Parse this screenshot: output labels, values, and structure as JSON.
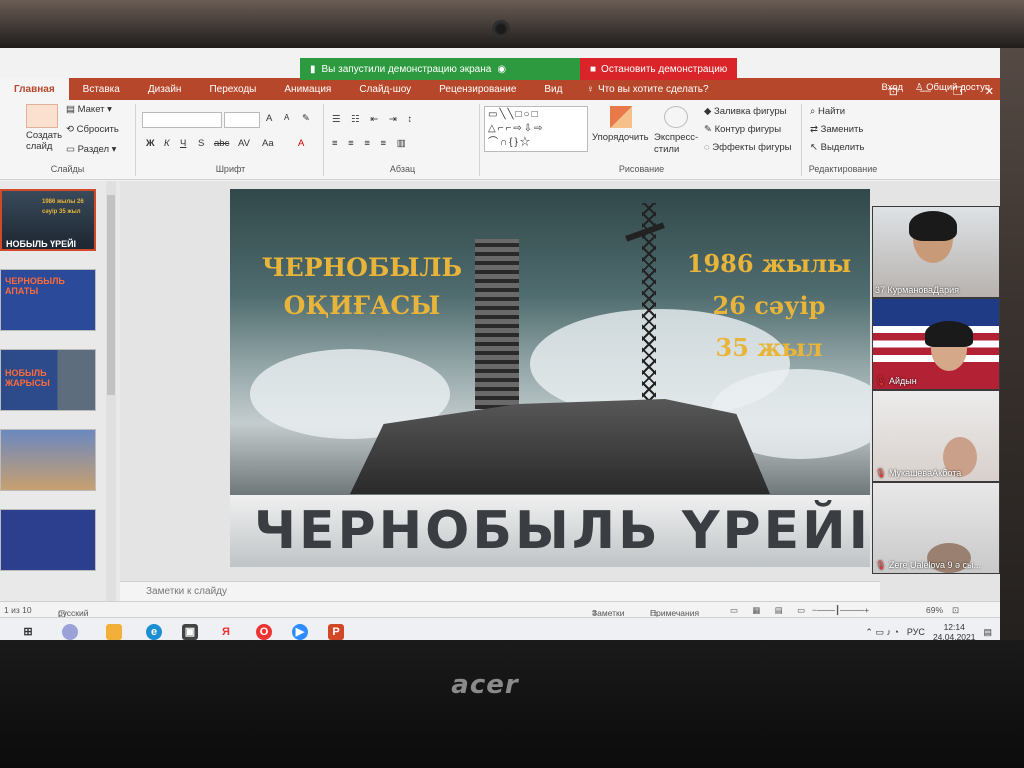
{
  "share": {
    "message": "Вы запустили демонстрацию экрана",
    "stop_label": "Остановить демонстрацию"
  },
  "ribbon_tabs": [
    "Главная",
    "Вставка",
    "Дизайн",
    "Переходы",
    "Анимация",
    "Слайд-шоу",
    "Рецензирование",
    "Вид"
  ],
  "tell_me": "Что вы хотите сделать?",
  "tab_right": {
    "signin": "Вход",
    "share": "Общий доступ"
  },
  "ribbon": {
    "slides": {
      "new_slide": "Создать слайд",
      "layout": "Макет",
      "reset": "Сбросить",
      "section": "Раздел",
      "label": "Слайды"
    },
    "font": {
      "label": "Шрифт",
      "bold": "Ж",
      "italic": "К",
      "underline": "Ч",
      "shadow": "S",
      "strikethrough": "abc",
      "spacing": "AV",
      "case": "Aa",
      "grow": "A",
      "shrink": "A"
    },
    "paragraph": {
      "label": "Абзац"
    },
    "drawing": {
      "label": "Рисование",
      "arrange": "Упорядочить",
      "quick_styles": "Экспресс-стили",
      "fill": "Заливка фигуры",
      "outline": "Контур фигуры",
      "effects": "Эффекты фигуры"
    },
    "editing": {
      "label": "Редактирование",
      "find": "Найти",
      "replace": "Заменить",
      "select": "Выделить"
    }
  },
  "slide": {
    "title_line1": "ЧЕРНОБЫЛЬ",
    "title_line2": "ОҚИҒАСЫ",
    "date_line1": "1986 жылы",
    "date_line2": "26 сәуір",
    "date_line3": "35 жыл",
    "banner": "ЧЕРНОБЫЛЬ ҮРЕЙІ"
  },
  "thumbnails": [
    {
      "label": "1986 жылы 26 сәуір 35 жыл",
      "title": "НОБЫЛЬ ҮРЕЙІ"
    },
    {
      "label": "ЧЕРНОБЫЛЬ АПАТЫ",
      "title": ""
    },
    {
      "label": "НОБЫЛЬ ЖАРЫСЫ",
      "title": ""
    },
    {
      "label": "",
      "title": ""
    },
    {
      "label": "",
      "title": ""
    }
  ],
  "participants": [
    {
      "name": "37 КурмановаДария"
    },
    {
      "name": "Айдын"
    },
    {
      "name": "МукашеваАкбота"
    },
    {
      "name": "Zere Ualelova 9 ә сы..."
    }
  ],
  "notes_placeholder": "Заметки к слайду",
  "status": {
    "slide_counter": "1 из 10",
    "language": "русский",
    "notes": "Заметки",
    "comments": "Примечания",
    "zoom": "69%"
  },
  "taskbar": {
    "lang": "РУС",
    "time": "12:14",
    "date": "24.04.2021"
  },
  "brand": "acer"
}
